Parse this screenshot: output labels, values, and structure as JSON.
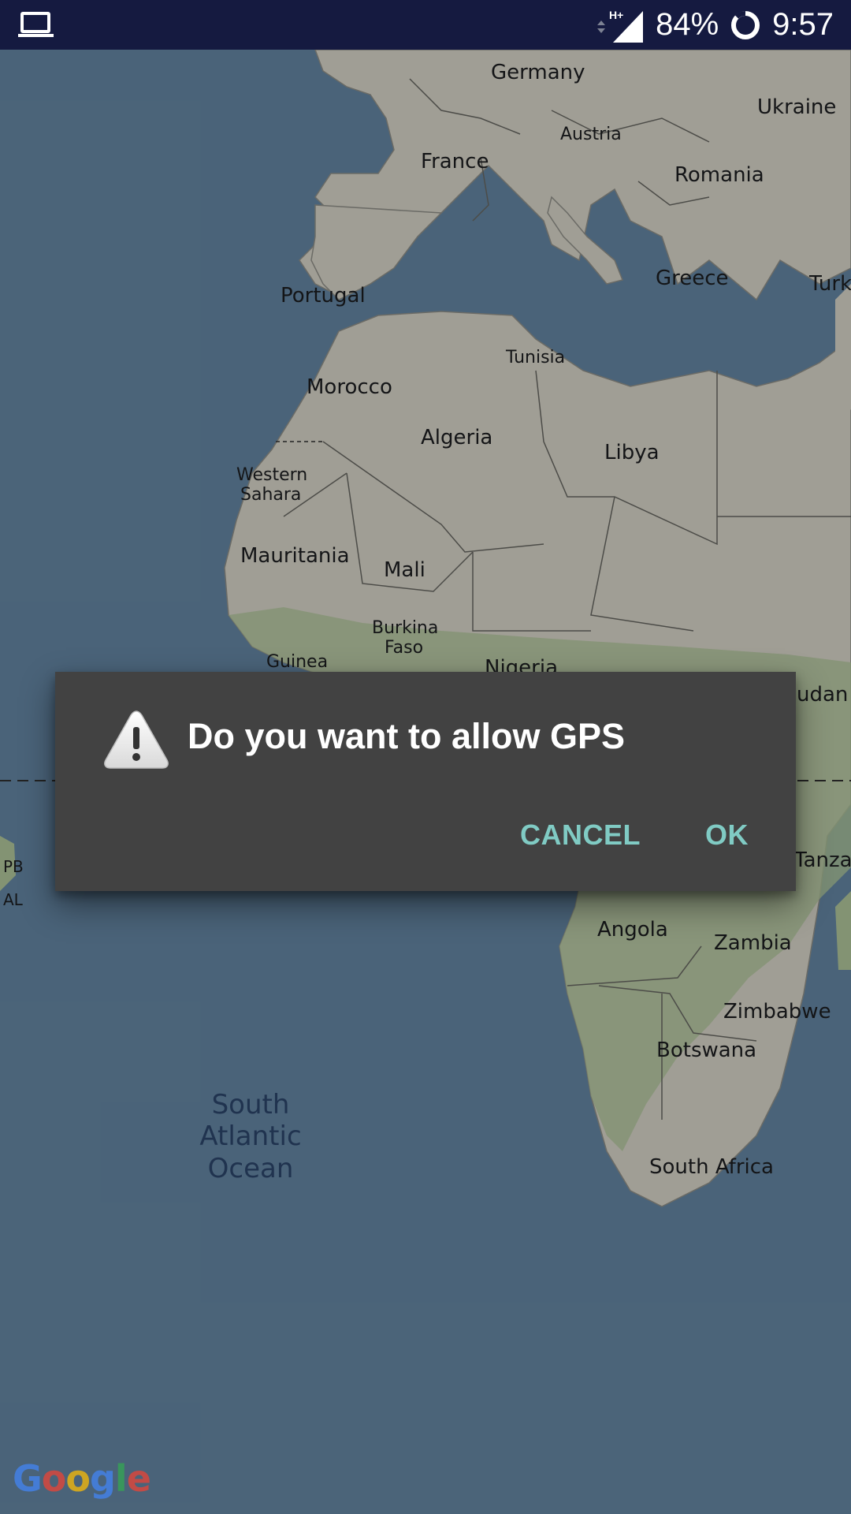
{
  "status_bar": {
    "left_icon": "laptop-icon",
    "network_type": "H+",
    "battery_percent": "84%",
    "time": "9:57",
    "signal_icon": "signal-icon",
    "battery_icon": "battery-ring-icon"
  },
  "map": {
    "labels": {
      "germany": "Germany",
      "ukraine": "Ukraine",
      "austria": "Austria",
      "france": "France",
      "romania": "Romania",
      "portugal": "Portugal",
      "greece": "Greece",
      "turkey": "Turk",
      "tunisia": "Tunisia",
      "morocco": "Morocco",
      "algeria": "Algeria",
      "libya": "Libya",
      "western_sahara_1": "Western",
      "western_sahara_2": "Sahara",
      "mauritania": "Mauritania",
      "mali": "Mali",
      "burkina_1": "Burkina",
      "burkina_2": "Faso",
      "guinea": "Guinea",
      "nigeria": "Nigeria",
      "sudan": "udan",
      "tanzania": "Tanza",
      "pb": "PB",
      "al": "AL",
      "angola": "Angola",
      "zambia": "Zambia",
      "zimbabwe": "Zimbabwe",
      "botswana": "Botswana",
      "south_africa": "South Africa",
      "ocean_1": "South",
      "ocean_2": "Atlantic",
      "ocean_3": "Ocean"
    },
    "logo_text": "Google",
    "colors": {
      "water": "#6b8fae",
      "land": "#e6e2d6",
      "vegetation": "#bcd3a5"
    }
  },
  "dialog": {
    "icon": "warning-icon",
    "title": "Do you want to allow GPS",
    "cancel_label": "CANCEL",
    "ok_label": "OK",
    "button_color": "#80cbc4"
  }
}
